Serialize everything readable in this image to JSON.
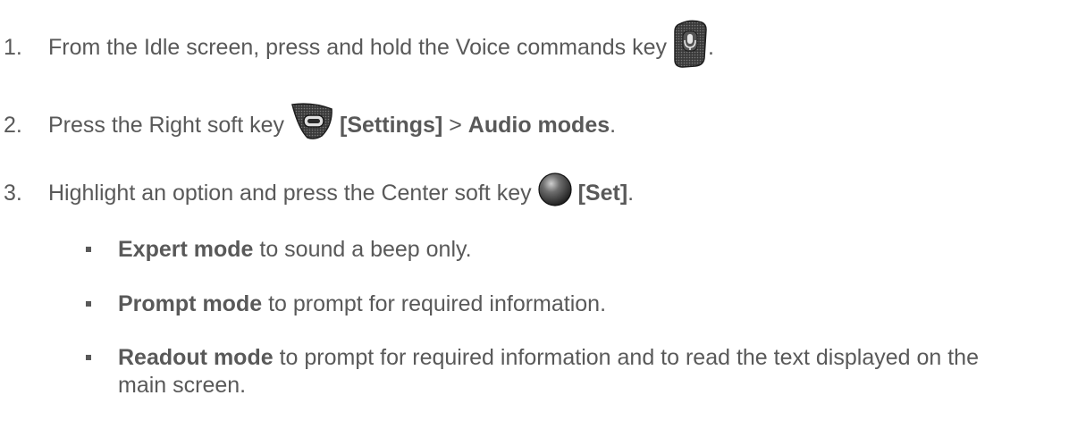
{
  "steps": [
    {
      "number": "1.",
      "text_before": "From the Idle screen, press and hold the Voice commands key",
      "icon": "voice-commands-key-icon",
      "text_after": "."
    },
    {
      "number": "2.",
      "text_before": "Press the Right soft key",
      "icon": "right-soft-key-icon",
      "bold_label": "[Settings]",
      "separator": " > ",
      "bold_menu": "Audio modes",
      "text_after": "."
    },
    {
      "number": "3.",
      "text_before": "Highlight an option and press the Center soft key",
      "icon": "center-soft-key-icon",
      "bold_label": "[Set]",
      "text_after": "."
    }
  ],
  "options": [
    {
      "name": "Expert mode",
      "description": " to sound a beep only."
    },
    {
      "name": "Prompt mode",
      "description": " to prompt for required information."
    },
    {
      "name": "Readout mode",
      "description": " to prompt for required information and to read the text displayed on the main screen."
    }
  ],
  "colors": {
    "text": "#595959",
    "key_dark": "#2b2b2b",
    "key_mid": "#6a6a6a"
  }
}
